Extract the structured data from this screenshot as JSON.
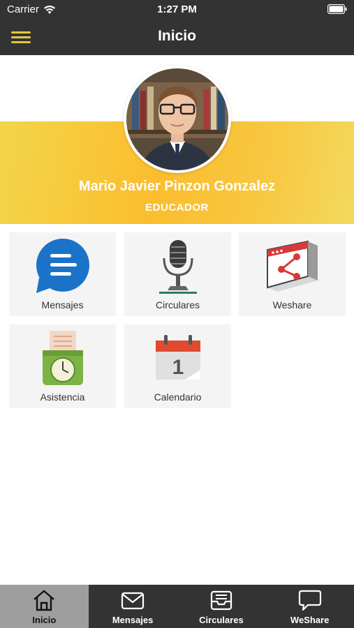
{
  "status_bar": {
    "carrier": "Carrier",
    "time": "1:27 PM"
  },
  "header": {
    "title": "Inicio"
  },
  "profile": {
    "name": "Mario Javier Pinzon Gonzalez",
    "role": "EDUCADOR"
  },
  "tiles": [
    {
      "label": "Mensajes",
      "icon": "chat-bubble-icon"
    },
    {
      "label": "Circulares",
      "icon": "microphone-icon"
    },
    {
      "label": "Weshare",
      "icon": "share-window-icon"
    },
    {
      "label": "Asistencia",
      "icon": "time-clock-icon"
    },
    {
      "label": "Calendario",
      "icon": "calendar-icon"
    }
  ],
  "tab_bar": {
    "items": [
      {
        "label": "Inicio",
        "icon": "home-icon",
        "active": true
      },
      {
        "label": "Mensajes",
        "icon": "envelope-icon",
        "active": false
      },
      {
        "label": "Circulares",
        "icon": "inbox-tray-icon",
        "active": false
      },
      {
        "label": "WeShare",
        "icon": "speech-bubble-icon",
        "active": false
      }
    ]
  },
  "colors": {
    "bar": "#333333",
    "accent": "#e6c640",
    "hero": "#fbbd2e",
    "tile": "#f4f4f4",
    "active_tab": "#9e9e9e"
  }
}
